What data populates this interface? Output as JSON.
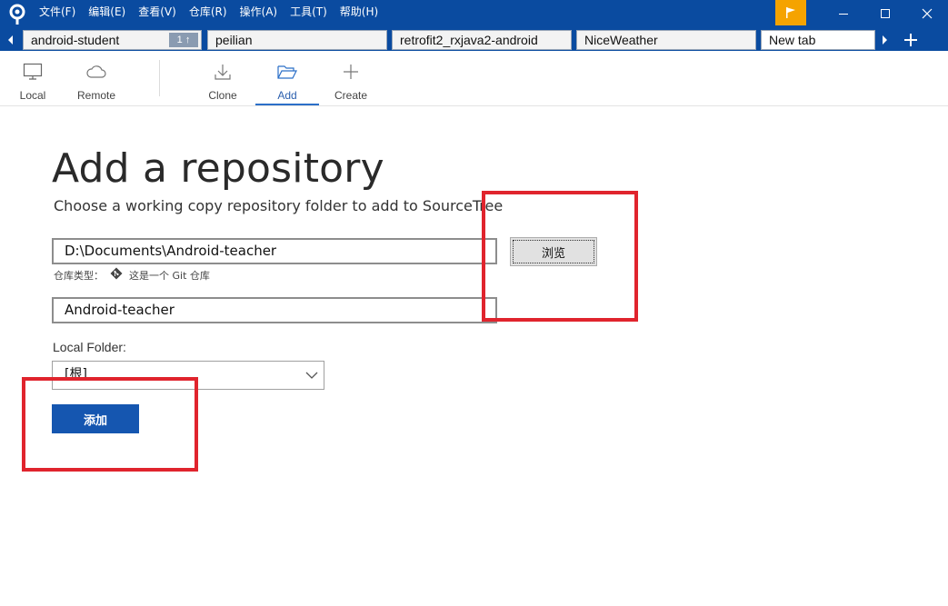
{
  "menu": [
    "文件(F)",
    "编辑(E)",
    "查看(V)",
    "仓库(R)",
    "操作(A)",
    "工具(T)",
    "帮助(H)"
  ],
  "tabs": [
    {
      "label": "android-student",
      "badge": "1 ↑"
    },
    {
      "label": "peilian"
    },
    {
      "label": "retrofit2_rxjava2-android"
    },
    {
      "label": "NiceWeather"
    },
    {
      "label": "New tab"
    }
  ],
  "toolbar": {
    "local": "Local",
    "remote": "Remote",
    "clone": "Clone",
    "add": "Add",
    "create": "Create"
  },
  "main": {
    "title": "Add a repository",
    "subtitle": "Choose a working copy repository folder to add to SourceTree",
    "path_value": "D:\\Documents\\Android-teacher",
    "browse_label": "浏览",
    "repo_type_label": "仓库类型：",
    "repo_type_value": "这是一个 Git 仓库",
    "name_value": "Android-teacher",
    "local_folder_label": "Local Folder:",
    "local_folder_value": "[根]",
    "add_button": "添加"
  },
  "colors": {
    "titlebar": "#0a4ba0",
    "accent": "#1556b0",
    "flag": "#f5a300",
    "annotation": "#e0242d"
  }
}
